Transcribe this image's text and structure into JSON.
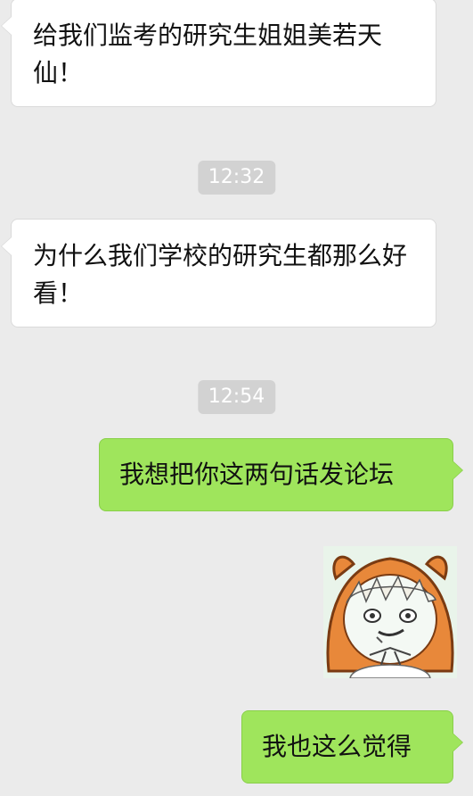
{
  "messages": [
    {
      "direction": "in",
      "text": "给我们监考的研究生姐姐美若天仙！"
    },
    {
      "timestamp": "12:32"
    },
    {
      "direction": "in",
      "text": "为什么我们学校的研究生都那么好看！"
    },
    {
      "timestamp": "12:54"
    },
    {
      "direction": "out",
      "text": "我想把你这两句话发论坛"
    },
    {
      "direction": "out",
      "sticker": "umaru-hamster-hood-sticker"
    },
    {
      "direction": "out",
      "text": "我也这么觉得"
    }
  ],
  "colors": {
    "background": "#ebebeb",
    "incoming_bubble": "#ffffff",
    "outgoing_bubble": "#9fe55c",
    "timestamp_pill": "#d2d2d2",
    "timestamp_text": "#ffffff"
  }
}
